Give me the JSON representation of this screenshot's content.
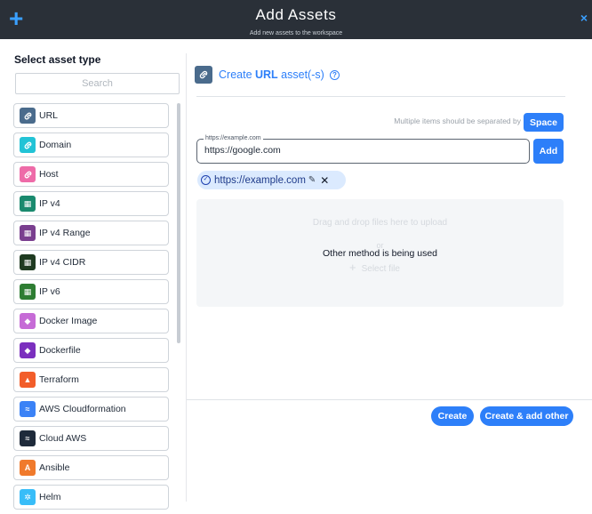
{
  "header": {
    "title": "Add Assets",
    "subtitle": "Add new assets to the workspace",
    "plus_glyph": "+",
    "close_glyph": "×"
  },
  "left": {
    "title": "Select asset type",
    "search_placeholder": "Search",
    "items": [
      {
        "label": "URL",
        "icon": "link-icon",
        "color": "#4a6b8c"
      },
      {
        "label": "Domain",
        "icon": "link-icon",
        "color": "#22c3d6"
      },
      {
        "label": "Host",
        "icon": "link-icon",
        "color": "#ee6ba8"
      },
      {
        "label": "IP v4",
        "icon": "ip-icon",
        "color": "#1a8a6e"
      },
      {
        "label": "IP v4 Range",
        "icon": "ip-icon",
        "color": "#7a3f8f"
      },
      {
        "label": "IP v4 CIDR",
        "icon": "ip-icon",
        "color": "#1f3b21"
      },
      {
        "label": "IP v6",
        "icon": "ip-icon",
        "color": "#2e7d32"
      },
      {
        "label": "Docker Image",
        "icon": "docker-icon",
        "color": "#c66bd6"
      },
      {
        "label": "Dockerfile",
        "icon": "docker-icon",
        "color": "#7b2fbe"
      },
      {
        "label": "Terraform",
        "icon": "terraform-icon",
        "color": "#f25d2a"
      },
      {
        "label": "AWS Cloudformation",
        "icon": "aws-icon",
        "color": "#3b82f6"
      },
      {
        "label": "Cloud AWS",
        "icon": "aws-icon",
        "color": "#1e2a3a"
      },
      {
        "label": "Ansible",
        "icon": "ansible-icon",
        "color": "#f07a2c"
      },
      {
        "label": "Helm",
        "icon": "helm-icon",
        "color": "#38bdf8"
      }
    ]
  },
  "right": {
    "create_prefix": "Create ",
    "create_bold": "URL",
    "create_suffix": " asset(-s)",
    "help_glyph": "?",
    "separator_hint": "Multiple items should be separated by",
    "space_label": "Space",
    "input_legend": "https://example.com",
    "input_value": "https://google.com",
    "add_label": "Add",
    "chip_label": "https://example.com",
    "dropzone_text": "Drag and drop files here to upload",
    "dropzone_or": "or",
    "dropzone_select": "Select file",
    "dropzone_overlay": "Other method is being used",
    "create_label": "Create",
    "create_add_label": "Create & add other"
  },
  "colors": {
    "accent": "#2d7ff9",
    "header_bg": "#2a3038"
  }
}
